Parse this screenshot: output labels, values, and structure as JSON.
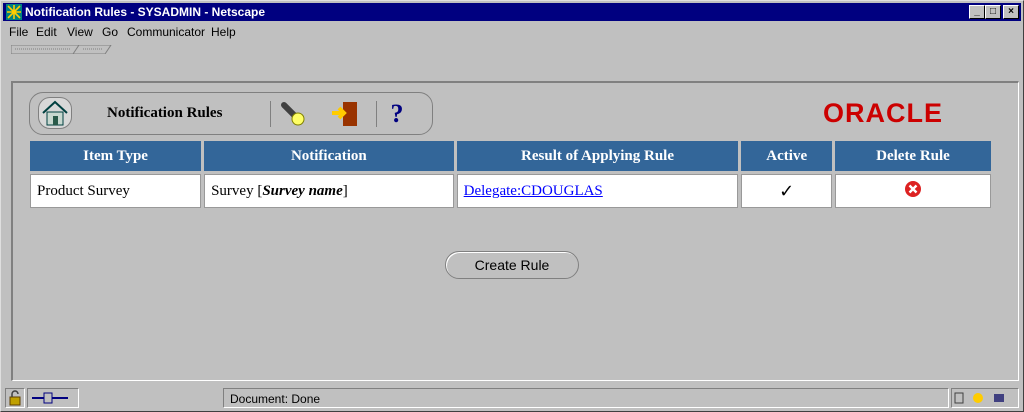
{
  "window": {
    "title": "Notification Rules - SYSADMIN - Netscape"
  },
  "menu": [
    "File",
    "Edit",
    "View",
    "Go",
    "Communicator",
    "Help"
  ],
  "toolbar": {
    "title": "Notification Rules",
    "help_label": "?"
  },
  "brand": {
    "logo_text": "ORACLE",
    "logo_color": "#cc0000"
  },
  "table": {
    "header_color": "#336699",
    "columns": [
      "Item Type",
      "Notification",
      "Result of Applying Rule",
      "Active",
      "Delete Rule"
    ],
    "rows": [
      {
        "item_type": "Product Survey",
        "notification_prefix": "Survey [",
        "notification_name": "Survey name",
        "notification_suffix": "]",
        "result": "Delegate:CDOUGLAS",
        "active": "✓"
      }
    ]
  },
  "actions": {
    "create_rule": "Create Rule"
  },
  "status": {
    "text": "Document: Done"
  }
}
